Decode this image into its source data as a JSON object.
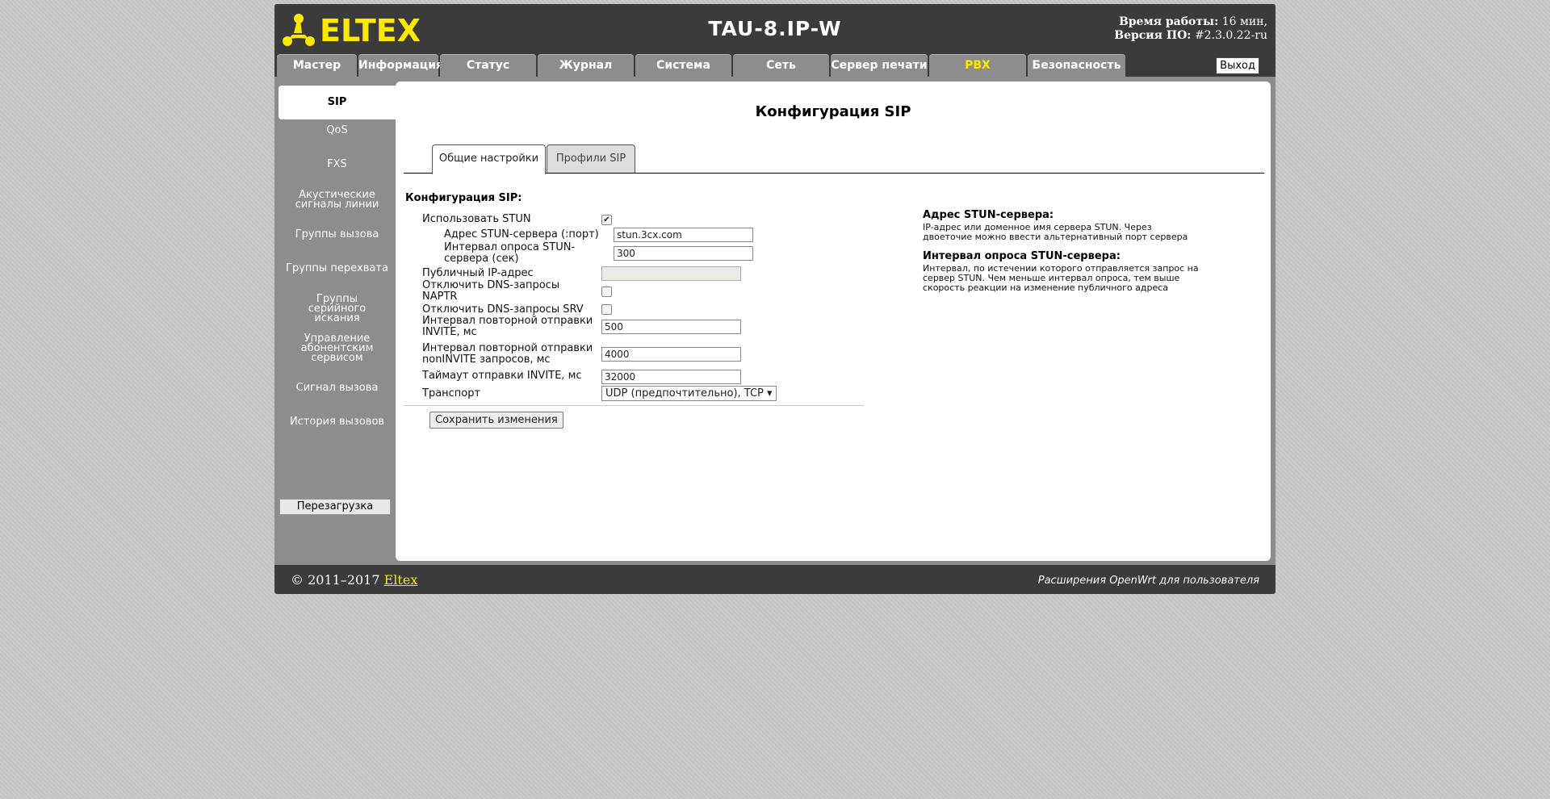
{
  "header": {
    "device_name": "TAU-8.IP-W",
    "uptime_label": "Время работы:",
    "uptime_value": "16 мин,",
    "version_label": "Версия ПО:",
    "version_value": "#2.3.0.22-ru",
    "logo_text": "ELTEX",
    "brand_color": "#ffe800"
  },
  "nav": {
    "tabs": [
      "Мастер",
      "Информация",
      "Статус",
      "Журнал",
      "Система",
      "Сеть",
      "Сервер печати",
      "PBX",
      "Безопасность"
    ],
    "active": "PBX",
    "logout": "Выход"
  },
  "sidebar": {
    "items": [
      "SIP",
      "QoS",
      "FXS",
      "Акустические сигналы линии",
      "Группы вызова",
      "Группы перехвата",
      "Группы серийного искания",
      "Управление абонентским сервисом",
      "Сигнал вызова",
      "История вызовов"
    ],
    "active": "SIP",
    "reboot": "Перезагрузка"
  },
  "content": {
    "title": "Конфигурация SIP",
    "tabs": [
      "Общие настройки",
      "Профили SIP"
    ],
    "active_tab": "Общие настройки",
    "form_title": "Конфигурация SIP:",
    "fields": {
      "use_stun": {
        "label": "Использовать STUN",
        "checked": true
      },
      "stun_addr": {
        "label": "Адрес STUN-сервера (:порт)",
        "value": "stun.3cx.com"
      },
      "stun_interval": {
        "label": "Интервал опроса STUN-сервера (сек)",
        "value": "300"
      },
      "public_ip": {
        "label": "Публичный IP-адрес",
        "value": ""
      },
      "dns_naptr": {
        "label": "Отключить DNS-запросы NAPTR",
        "checked": false
      },
      "dns_srv": {
        "label": "Отключить DNS-запросы SRV",
        "checked": false
      },
      "invite_retry": {
        "label": "Интервал повторной отправки INVITE, мс",
        "value": "500"
      },
      "noninvite_retry": {
        "label": "Интервал повторной отправки nonINVITE запросов, мс",
        "value": "4000"
      },
      "invite_timeout": {
        "label": "Таймаут отправки INVITE, мс",
        "value": "32000"
      },
      "transport": {
        "label": "Транспорт",
        "value": "UDP (предпочтительно), TCP"
      }
    },
    "save": "Сохранить изменения",
    "help": [
      {
        "title": "Адрес STUN-сервера:",
        "text": "IP-адрес или доменное имя сервера STUN. Через двоеточие можно ввести альтернативный порт сервера"
      },
      {
        "title": "Интервал опроса STUN-сервера:",
        "text": "Интервал, по истечении которого отправляется запрос на сервер STUN. Чем меньше интервал опроса, тем выше скорость реакции на изменение публичного адреса"
      }
    ]
  },
  "footer": {
    "copyright": "© 2011–2017",
    "company_link": "Eltex",
    "extension_text": "Расширения OpenWrt для пользователя"
  }
}
